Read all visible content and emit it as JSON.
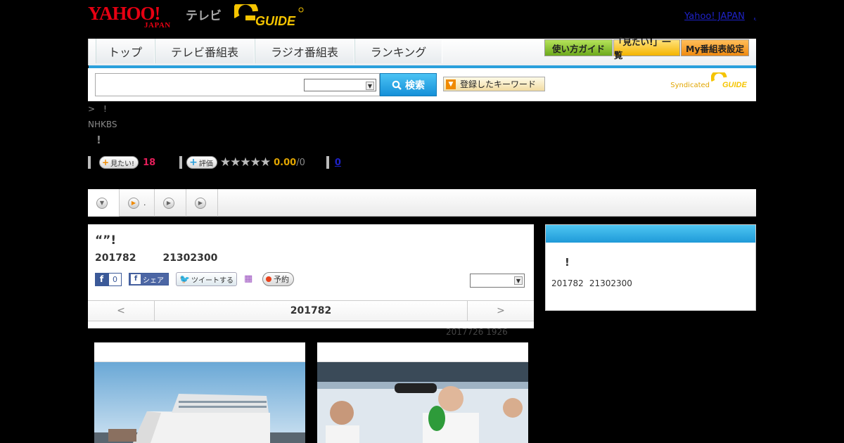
{
  "header": {
    "yahoo_logo": "YAHOO!",
    "yahoo_logo_sub": "JAPAN",
    "tv_label": "テレビ",
    "gguide_logo": "G-GUIDE",
    "yahoo_japan_link": "Yahoo! JAPAN",
    "yahoo_japan_extra": ","
  },
  "nav": {
    "tabs": [
      {
        "label": "トップ"
      },
      {
        "label": "テレビ番組表"
      },
      {
        "label": "ラジオ番組表"
      },
      {
        "label": "ランキング"
      }
    ],
    "buttons": [
      {
        "label": "使い方ガイド",
        "color": "#8cc63f"
      },
      {
        "label": "「見たい!」一覧",
        "color": "#f4b400"
      },
      {
        "label": "My番組表設定",
        "color": "#ef8a10"
      }
    ]
  },
  "search": {
    "input_value": "",
    "select_value": "",
    "button_label": "検索",
    "keyword_button_label": "登録したキーワード",
    "syndicated_label": "Syndicated"
  },
  "program": {
    "breadcrumb": ">　!",
    "channel": "NHKBS",
    "title_short": "!",
    "want_label": "見たい!",
    "want_count": "18",
    "rate_label": "評価",
    "stars": "★★★★★",
    "rating": "0.00",
    "rating_total": "/0",
    "review_count": "0"
  },
  "tabs": [
    {
      "label": ""
    },
    {
      "label": "."
    },
    {
      "label": ""
    },
    {
      "label": ""
    }
  ],
  "detail": {
    "title": "“”!",
    "date": "201782",
    "time": "21302300",
    "fb_count": "0",
    "fb_share_label": "シェア",
    "tweet_label": "ツイートする",
    "reserve_label": "予約",
    "select_value": "",
    "nav_prev": "<",
    "nav_date": "201782",
    "nav_next": ">",
    "updated": "2017726  1926"
  },
  "side": {
    "title": "!",
    "date": "201782",
    "time": "21302300"
  },
  "colors": {
    "brand_red": "#e60012",
    "accent_blue": "#2aa0dc",
    "gguide_yellow": "#f5c400"
  }
}
